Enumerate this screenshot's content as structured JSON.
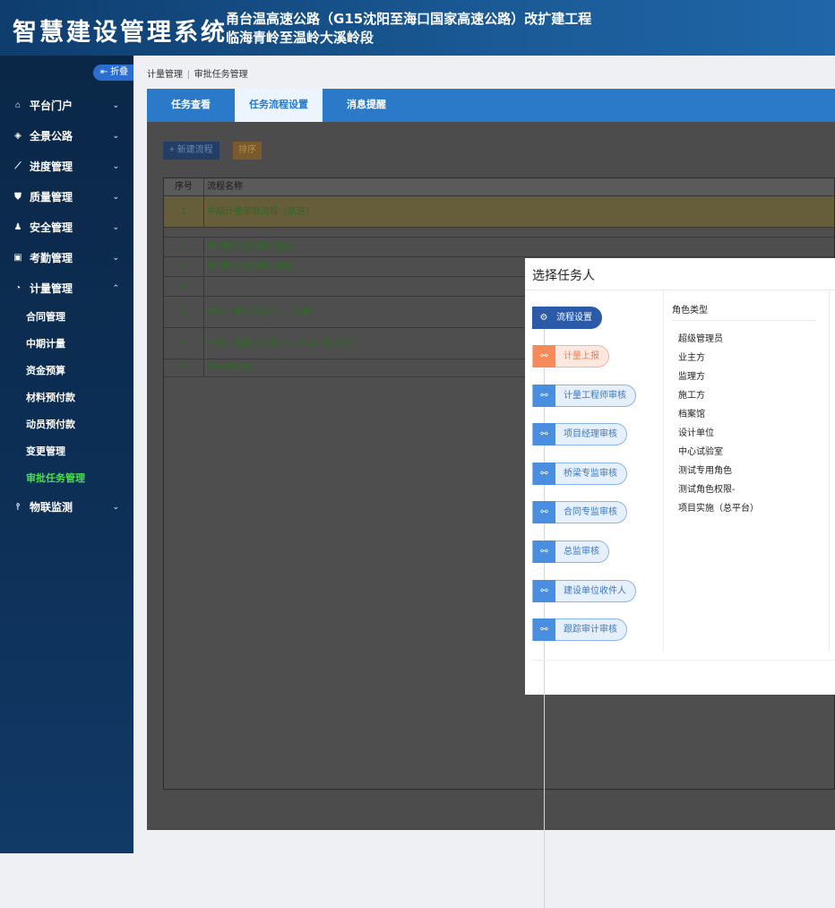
{
  "header": {
    "system_title": "智慧建设管理系统",
    "project_line1": "甬台温高速公路（G15沈阳至海口国家高速公路）改扩建工程",
    "project_line2": "临海青岭至温岭大溪岭段"
  },
  "sidebar": {
    "collapse_label": "折叠",
    "items": [
      {
        "label": "平台门户",
        "icon": "home-icon"
      },
      {
        "label": "全景公路",
        "icon": "panorama-icon"
      },
      {
        "label": "进度管理",
        "icon": "chart-icon"
      },
      {
        "label": "质量管理",
        "icon": "shield-icon"
      },
      {
        "label": "安全管理",
        "icon": "user-icon"
      },
      {
        "label": "考勤管理",
        "icon": "calendar-icon"
      },
      {
        "label": "计量管理",
        "icon": "gauge-icon"
      },
      {
        "label": "物联监测",
        "icon": "sensor-icon"
      }
    ],
    "sub_items": [
      {
        "label": "合同管理"
      },
      {
        "label": "中期计量"
      },
      {
        "label": "资金预算"
      },
      {
        "label": "材料预付款"
      },
      {
        "label": "动员预付款"
      },
      {
        "label": "变更管理"
      },
      {
        "label": "审批任务管理"
      }
    ]
  },
  "breadcrumb": {
    "parent": "计量管理",
    "separator": "|",
    "current": "审批任务管理"
  },
  "tabs": [
    {
      "label": "任务查看"
    },
    {
      "label": "任务流程设置"
    },
    {
      "label": "消息提醒"
    }
  ],
  "toolbar": {
    "new_label": "+ 新建流程",
    "sort_label": "排序"
  },
  "table": {
    "headers": [
      "序号",
      "流程名称"
    ],
    "rows": [
      {
        "no": "1",
        "name": "中期计量审批流程（高速）"
      },
      {
        "no": "2",
        "name": "第1期预付款审批流程"
      },
      {
        "no": "3",
        "name": "第2期预付款审批流程"
      },
      {
        "no": "4",
        "name": ""
      },
      {
        "no": "5",
        "name": "中期计量审批流程）（变更）"
      },
      {
        "no": "6",
        "name": "中期计量审批流程（2025年2月24日）"
      },
      {
        "no": "7",
        "name": "材料预付款"
      }
    ]
  },
  "dialog": {
    "title": "选择任务人",
    "flow_nodes": [
      {
        "label": "流程设置"
      },
      {
        "label": "计量上报"
      },
      {
        "label": "计量工程师审核"
      },
      {
        "label": "项目经理审核"
      },
      {
        "label": "桥梁专监审核"
      },
      {
        "label": "合同专监审核"
      },
      {
        "label": "总监审核"
      },
      {
        "label": "建设单位收件人"
      },
      {
        "label": "跟踪审计审核"
      }
    ],
    "role_header": "角色类型",
    "roles": [
      "超级管理员",
      "业主方",
      "监理方",
      "施工方",
      "档案馆",
      "设计单位",
      "中心试验室",
      "测试专用角色",
      "测试角色权限-",
      "项目实施（总平台）"
    ]
  },
  "colors": {
    "accent": "#2a7ac9",
    "active_menu": "#48e04a",
    "orange": "#f58a5b"
  }
}
